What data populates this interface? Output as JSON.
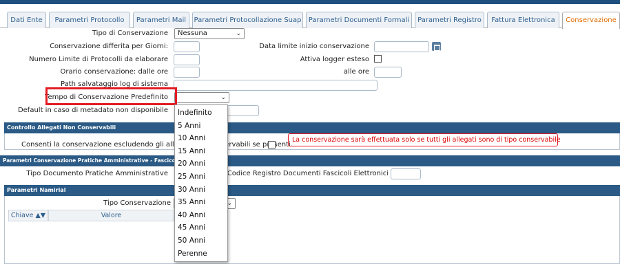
{
  "tabs": [
    {
      "label": "Dati Ente",
      "active": false
    },
    {
      "label": "Parametri Protocollo",
      "active": false
    },
    {
      "label": "Parametri Mail",
      "active": false
    },
    {
      "label": "Parametri Protocollazione Suap",
      "active": false
    },
    {
      "label": "Parametri Documenti Formali",
      "active": false
    },
    {
      "label": "Parametri Registro",
      "active": false
    },
    {
      "label": "Fattura Elettronica",
      "active": false
    },
    {
      "label": "Conservazione",
      "active": true
    }
  ],
  "form": {
    "tipo_conservazione_label": "Tipo di Conservazione",
    "tipo_conservazione_value": "Nessuna",
    "differita_label": "Conservazione differita per Giorni:",
    "data_limite_label": "Data limite inizio conservazione",
    "numero_limite_label": "Numero Limite di Protocolli da elaborare",
    "logger_label": "Attiva logger esteso",
    "orario_dalle_label": "Orario conservazione: dalle ore",
    "alle_ore_label": "alle ore",
    "path_log_label": "Path salvataggio log di sistema",
    "tempo_predefinito_label": "Tempo di Conservazione Predefinito",
    "default_metadato_label": "Default in caso di metadato non disponibile"
  },
  "section_allegati": {
    "title": "Controllo Allegati Non Conservabili",
    "consenti_label": "Consenti la conservazione escludendo gli allegati non conservabili se presenti.",
    "warning": "La conservazione sarà effettuata solo se tutti gli allegati sono di tipo conservabile"
  },
  "section_pratiche": {
    "title": "Parametri Conservazione Pratiche Amministrative - Fascicoli Elettronici",
    "tipo_documento_label": "Tipo Documento Pratiche Amministrative",
    "codice_registro_label": "Codice Registro Documenti Fascicoli Elettronici"
  },
  "section_namirial": {
    "title": "Parametri Namirial",
    "tipo_conservazione_label": "Tipo Conservazione",
    "col_chiave": "Chiave",
    "col_valore": "Valore",
    "sort_icon": "sort-icon"
  },
  "dropdown_options": [
    "Indefinito",
    "5 Anni",
    "10 Anni",
    "15 Anni",
    "20 Anni",
    "25 Anni",
    "30 Anni",
    "35 Anni",
    "40 Anni",
    "45 Anni",
    "50 Anni",
    "Perenne"
  ],
  "colors": {
    "accent": "#e06c00",
    "header": "#2a5a85",
    "highlight": "#e31b23"
  }
}
